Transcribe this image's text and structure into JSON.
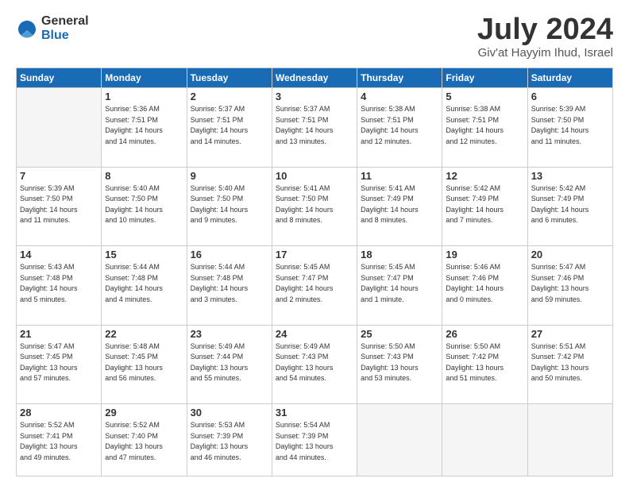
{
  "logo": {
    "general": "General",
    "blue": "Blue"
  },
  "title": "July 2024",
  "location": "Giv'at Hayyim Ihud, Israel",
  "headers": [
    "Sunday",
    "Monday",
    "Tuesday",
    "Wednesday",
    "Thursday",
    "Friday",
    "Saturday"
  ],
  "weeks": [
    [
      {
        "day": "",
        "info": ""
      },
      {
        "day": "1",
        "info": "Sunrise: 5:36 AM\nSunset: 7:51 PM\nDaylight: 14 hours\nand 14 minutes."
      },
      {
        "day": "2",
        "info": "Sunrise: 5:37 AM\nSunset: 7:51 PM\nDaylight: 14 hours\nand 14 minutes."
      },
      {
        "day": "3",
        "info": "Sunrise: 5:37 AM\nSunset: 7:51 PM\nDaylight: 14 hours\nand 13 minutes."
      },
      {
        "day": "4",
        "info": "Sunrise: 5:38 AM\nSunset: 7:51 PM\nDaylight: 14 hours\nand 12 minutes."
      },
      {
        "day": "5",
        "info": "Sunrise: 5:38 AM\nSunset: 7:51 PM\nDaylight: 14 hours\nand 12 minutes."
      },
      {
        "day": "6",
        "info": "Sunrise: 5:39 AM\nSunset: 7:50 PM\nDaylight: 14 hours\nand 11 minutes."
      }
    ],
    [
      {
        "day": "7",
        "info": "Sunrise: 5:39 AM\nSunset: 7:50 PM\nDaylight: 14 hours\nand 11 minutes."
      },
      {
        "day": "8",
        "info": "Sunrise: 5:40 AM\nSunset: 7:50 PM\nDaylight: 14 hours\nand 10 minutes."
      },
      {
        "day": "9",
        "info": "Sunrise: 5:40 AM\nSunset: 7:50 PM\nDaylight: 14 hours\nand 9 minutes."
      },
      {
        "day": "10",
        "info": "Sunrise: 5:41 AM\nSunset: 7:50 PM\nDaylight: 14 hours\nand 8 minutes."
      },
      {
        "day": "11",
        "info": "Sunrise: 5:41 AM\nSunset: 7:49 PM\nDaylight: 14 hours\nand 8 minutes."
      },
      {
        "day": "12",
        "info": "Sunrise: 5:42 AM\nSunset: 7:49 PM\nDaylight: 14 hours\nand 7 minutes."
      },
      {
        "day": "13",
        "info": "Sunrise: 5:42 AM\nSunset: 7:49 PM\nDaylight: 14 hours\nand 6 minutes."
      }
    ],
    [
      {
        "day": "14",
        "info": "Sunrise: 5:43 AM\nSunset: 7:48 PM\nDaylight: 14 hours\nand 5 minutes."
      },
      {
        "day": "15",
        "info": "Sunrise: 5:44 AM\nSunset: 7:48 PM\nDaylight: 14 hours\nand 4 minutes."
      },
      {
        "day": "16",
        "info": "Sunrise: 5:44 AM\nSunset: 7:48 PM\nDaylight: 14 hours\nand 3 minutes."
      },
      {
        "day": "17",
        "info": "Sunrise: 5:45 AM\nSunset: 7:47 PM\nDaylight: 14 hours\nand 2 minutes."
      },
      {
        "day": "18",
        "info": "Sunrise: 5:45 AM\nSunset: 7:47 PM\nDaylight: 14 hours\nand 1 minute."
      },
      {
        "day": "19",
        "info": "Sunrise: 5:46 AM\nSunset: 7:46 PM\nDaylight: 14 hours\nand 0 minutes."
      },
      {
        "day": "20",
        "info": "Sunrise: 5:47 AM\nSunset: 7:46 PM\nDaylight: 13 hours\nand 59 minutes."
      }
    ],
    [
      {
        "day": "21",
        "info": "Sunrise: 5:47 AM\nSunset: 7:45 PM\nDaylight: 13 hours\nand 57 minutes."
      },
      {
        "day": "22",
        "info": "Sunrise: 5:48 AM\nSunset: 7:45 PM\nDaylight: 13 hours\nand 56 minutes."
      },
      {
        "day": "23",
        "info": "Sunrise: 5:49 AM\nSunset: 7:44 PM\nDaylight: 13 hours\nand 55 minutes."
      },
      {
        "day": "24",
        "info": "Sunrise: 5:49 AM\nSunset: 7:43 PM\nDaylight: 13 hours\nand 54 minutes."
      },
      {
        "day": "25",
        "info": "Sunrise: 5:50 AM\nSunset: 7:43 PM\nDaylight: 13 hours\nand 53 minutes."
      },
      {
        "day": "26",
        "info": "Sunrise: 5:50 AM\nSunset: 7:42 PM\nDaylight: 13 hours\nand 51 minutes."
      },
      {
        "day": "27",
        "info": "Sunrise: 5:51 AM\nSunset: 7:42 PM\nDaylight: 13 hours\nand 50 minutes."
      }
    ],
    [
      {
        "day": "28",
        "info": "Sunrise: 5:52 AM\nSunset: 7:41 PM\nDaylight: 13 hours\nand 49 minutes."
      },
      {
        "day": "29",
        "info": "Sunrise: 5:52 AM\nSunset: 7:40 PM\nDaylight: 13 hours\nand 47 minutes."
      },
      {
        "day": "30",
        "info": "Sunrise: 5:53 AM\nSunset: 7:39 PM\nDaylight: 13 hours\nand 46 minutes."
      },
      {
        "day": "31",
        "info": "Sunrise: 5:54 AM\nSunset: 7:39 PM\nDaylight: 13 hours\nand 44 minutes."
      },
      {
        "day": "",
        "info": ""
      },
      {
        "day": "",
        "info": ""
      },
      {
        "day": "",
        "info": ""
      }
    ]
  ]
}
